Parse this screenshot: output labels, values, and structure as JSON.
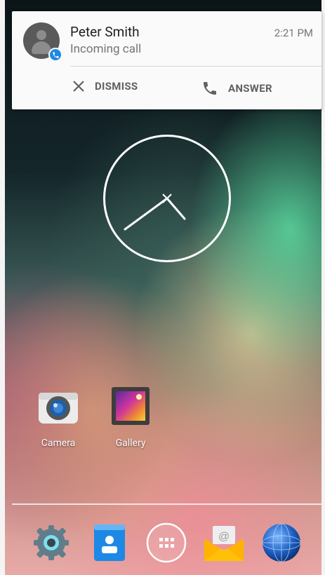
{
  "notification": {
    "caller_name": "Peter Smith",
    "status_text": "Incoming call",
    "time": "2:21 PM",
    "dismiss_label": "DISMISS",
    "answer_label": "ANSWER",
    "badge_color": "#1e88e5"
  },
  "home": {
    "apps": [
      {
        "label": "Camera",
        "icon": "camera-icon"
      },
      {
        "label": "Gallery",
        "icon": "gallery-icon"
      }
    ],
    "dock": [
      {
        "icon": "settings-icon"
      },
      {
        "icon": "contacts-icon"
      },
      {
        "icon": "app-drawer-icon"
      },
      {
        "icon": "email-icon"
      },
      {
        "icon": "browser-icon"
      }
    ]
  }
}
